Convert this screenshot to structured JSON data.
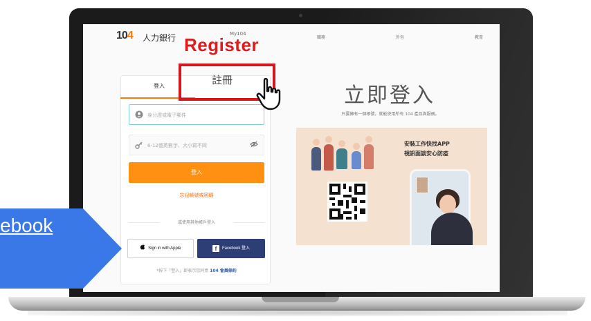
{
  "website": {
    "logo_number": "104",
    "brand_name": "人力銀行",
    "nav": {
      "my104": "My104",
      "item_1": "職務",
      "item_2": "外包",
      "item_3": "教育"
    }
  },
  "login_card": {
    "tab_login": "登入",
    "tab_register": "註冊",
    "account_placeholder": "身分證或電子郵件",
    "password_placeholder": "6-12個英數字，大小寫不同",
    "login_button": "登入",
    "forgot_link": "忘記帳號或密碼",
    "divider_text": "或使用其他帳戶登入",
    "apple_button": "Sign in with Apple",
    "facebook_button": "Facebook 登入",
    "terms_prefix": "*按下「登入」即表示您同意",
    "terms_link": "104 會員條約"
  },
  "hero": {
    "title": "立即登入",
    "subtitle": "只要擁有一個帳號，就能使用所有 104 產品與服務。"
  },
  "promo": {
    "line_1": "安裝工作快找APP",
    "line_2": "視訊面談安心防疫"
  },
  "annotations": {
    "register_label": "Register",
    "callout_text": "ebook",
    "highlight_color": "#d7161b",
    "callout_color": "#3b78e7"
  },
  "icons": {
    "account": "person-circle-icon",
    "password": "key-icon",
    "visibility": "eye-slash-icon",
    "apple": "apple-icon",
    "facebook": "facebook-icon",
    "pointer": "hand-pointer-icon"
  }
}
